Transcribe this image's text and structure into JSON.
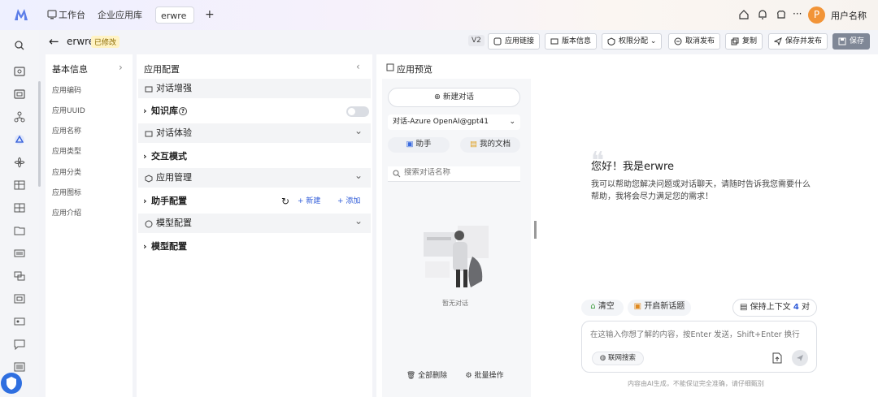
{
  "topbar": {
    "tabs": [
      "工作台",
      "企业应用库",
      "erwre"
    ],
    "add_tab": "+",
    "more": "···",
    "avatar_letter": "P",
    "username": "用户名称",
    "chevron": "⌄"
  },
  "subheader": {
    "app_name": "erwre",
    "modified_badge": "已修改",
    "version": "V2",
    "buttons": {
      "app_link": "应用链接",
      "version_info": "版本信息",
      "permission": "权限分配",
      "cancel_publish": "取消发布",
      "copy": "复制",
      "save_publish": "保存并发布",
      "save": "保存"
    }
  },
  "info_panel": {
    "title": "基本信息",
    "chevron": "›",
    "items": [
      "应用编码",
      "应用UUID",
      "应用名称",
      "应用类型",
      "应用分类",
      "应用图标",
      "应用介绍"
    ]
  },
  "config_panel": {
    "title": "应用配置",
    "collapse": "‹",
    "sections": {
      "dialog_enhance": "对话增强",
      "knowledge_base": "知识库",
      "dialog_experience": "对话体验",
      "interaction_mode": "交互模式",
      "app_management": "应用管理",
      "assistant_config": "助手配置",
      "model_config_1": "模型配置",
      "model_config_2": "模型配置"
    },
    "new_label": "+ 新建",
    "add_label": "+ 添加",
    "arrow": "›",
    "help": "?",
    "expand": "⌄"
  },
  "preview": {
    "title": "应用预览",
    "new_chat": "新建对话",
    "model_select": "对话-Azure OpenAI@gpt41",
    "assistant": "助手",
    "my_docs": "我的文档",
    "search_placeholder": "搜索对话名称",
    "empty_text": "暂无对话",
    "delete_all": "全部删除",
    "batch_ops": "批量操作",
    "greeting_title": "您好！我是erwre",
    "greeting_body": "我可以帮助您解决问题或对话聊天，请随时告诉我您需要什么帮助，我将会尽力满足您的需求！",
    "quote": "❝",
    "clear": "清空",
    "new_topic": "开启新话题",
    "keep_context": "保持上下文",
    "context_count": "4",
    "context_unit": "对",
    "input_placeholder": "在这输入你想了解的内容，按Enter 发送，Shift+Enter 换行",
    "web_search": "联网搜索",
    "disclaimer": "内容由AI生成，不能保证完全准确，请仔细甄别"
  },
  "colors": {
    "accent": "#2f5bd8",
    "badge_bg": "#fff3c4",
    "save_bg": "#7f8796"
  }
}
